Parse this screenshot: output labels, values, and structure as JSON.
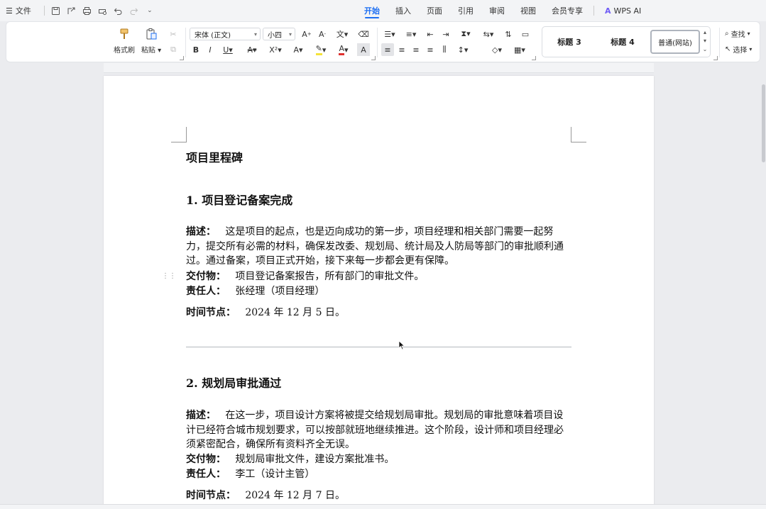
{
  "topbar": {
    "menu_icon": "hamburger-icon",
    "file_label": "文件",
    "quick_access": [
      "save-icon",
      "export-icon",
      "print-icon",
      "print-preview-icon",
      "undo-icon",
      "redo-icon",
      "more-icon"
    ],
    "tabs": [
      {
        "label": "开始",
        "active": true
      },
      {
        "label": "插入",
        "active": false
      },
      {
        "label": "页面",
        "active": false
      },
      {
        "label": "引用",
        "active": false
      },
      {
        "label": "审阅",
        "active": false
      },
      {
        "label": "视图",
        "active": false
      },
      {
        "label": "会员专享",
        "active": false
      },
      {
        "label": "WPS AI",
        "active": false
      }
    ]
  },
  "ribbon": {
    "format_painter": "格式刷",
    "paste": "粘贴",
    "font_name": "宋体 (正文)",
    "font_size": "小四",
    "styles": [
      "标题 3",
      "标题 4",
      "普通(网站)"
    ],
    "find": "查找",
    "select": "选择"
  },
  "document": {
    "title": "项目里程碑",
    "sections": [
      {
        "heading": "1. 项目登记备案完成",
        "desc_label": "描述：",
        "desc_text": "这是项目的起点，也是迈向成功的第一步，项目经理和相关部门需要一起努力，提交所有必需的材料，确保发改委、规划局、统计局及人防局等部门的审批顺利通过。通过备案，项目正式开始，接下来每一步都会更有保障。",
        "deliverable_label": "交付物：",
        "deliverable_text": "项目登记备案报告，所有部门的审批文件。",
        "owner_label": "责任人：",
        "owner_text": "张经理（项目经理）",
        "time_label": "时间节点：",
        "time_text": "2024 年 12 月 5 日。"
      },
      {
        "heading": "2. 规划局审批通过",
        "desc_label": "描述：",
        "desc_text": "在这一步，项目设计方案将被提交给规划局审批。规划局的审批意味着项目设计已经符合城市规划要求，可以按部就班地继续推进。这个阶段，设计师和项目经理必须紧密配合，确保所有资料齐全无误。",
        "deliverable_label": "交付物：",
        "deliverable_text": "规划局审批文件，建设方案批准书。",
        "owner_label": "责任人：",
        "owner_text": "李工（设计主管）",
        "time_label": "时间节点：",
        "time_text": "2024 年 12 月 7 日。"
      }
    ]
  }
}
